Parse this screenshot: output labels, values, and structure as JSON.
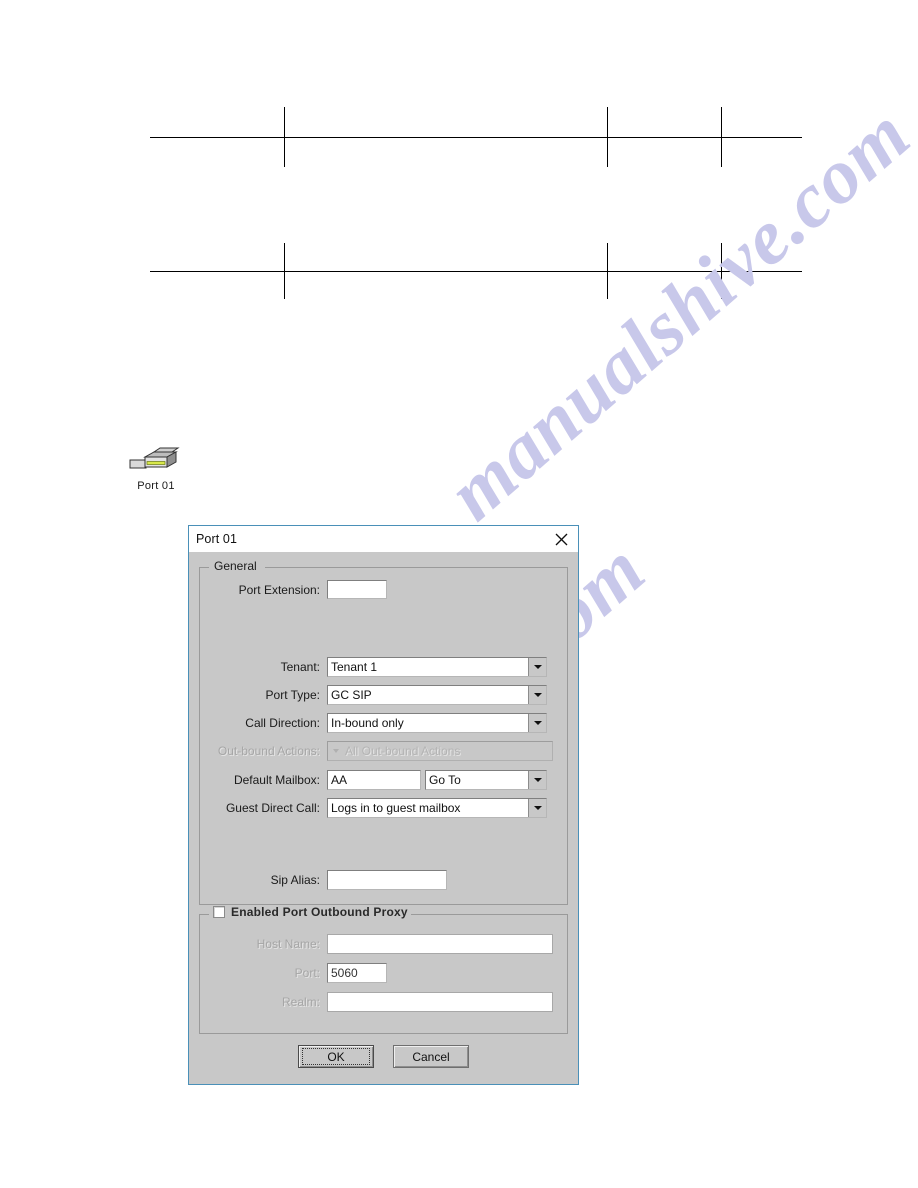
{
  "page": {
    "watermark_text": "manualshive.com"
  },
  "document": {
    "tables": [
      {
        "label": "table-fragment-top"
      },
      {
        "label": "table-fragment-bottom"
      }
    ]
  },
  "desktop_icon": {
    "name": "port-connector-icon",
    "label": "Port 01"
  },
  "dialog": {
    "title": "Port 01",
    "close_label": "✕",
    "general": {
      "legend": "General",
      "fields": {
        "port_extension": {
          "label": "Port Extension:",
          "value": ""
        },
        "tenant": {
          "label": "Tenant:",
          "value": "Tenant 1"
        },
        "port_type": {
          "label": "Port Type:",
          "value": "GC SIP"
        },
        "call_direction": {
          "label": "Call Direction:",
          "value": "In-bound only"
        },
        "outbound_actions": {
          "label": "Out-bound Actions:",
          "value": "All Out-bound Actions",
          "enabled": false
        },
        "default_mailbox": {
          "label": "Default Mailbox:",
          "value": "AA",
          "action_value": "Go To"
        },
        "guest_direct_call": {
          "label": "Guest Direct Call:",
          "value": "Logs in to guest mailbox"
        },
        "sip_alias": {
          "label": "Sip Alias:",
          "value": ""
        }
      }
    },
    "proxy": {
      "legend": "Enabled Port Outbound Proxy",
      "checked": false,
      "fields": {
        "host_name": {
          "label": "Host Name:",
          "value": ""
        },
        "port": {
          "label": "Port:",
          "value": "5060"
        },
        "realm": {
          "label": "Realm:",
          "value": ""
        }
      }
    },
    "buttons": {
      "ok": "OK",
      "cancel": "Cancel"
    }
  },
  "colors": {
    "dialog_face": "#c8c8c8",
    "dialog_border": "#4a90b8",
    "field_bg": "#ffffff",
    "disabled_text": "#b4b4b4",
    "watermark": "#c8c8ea"
  }
}
